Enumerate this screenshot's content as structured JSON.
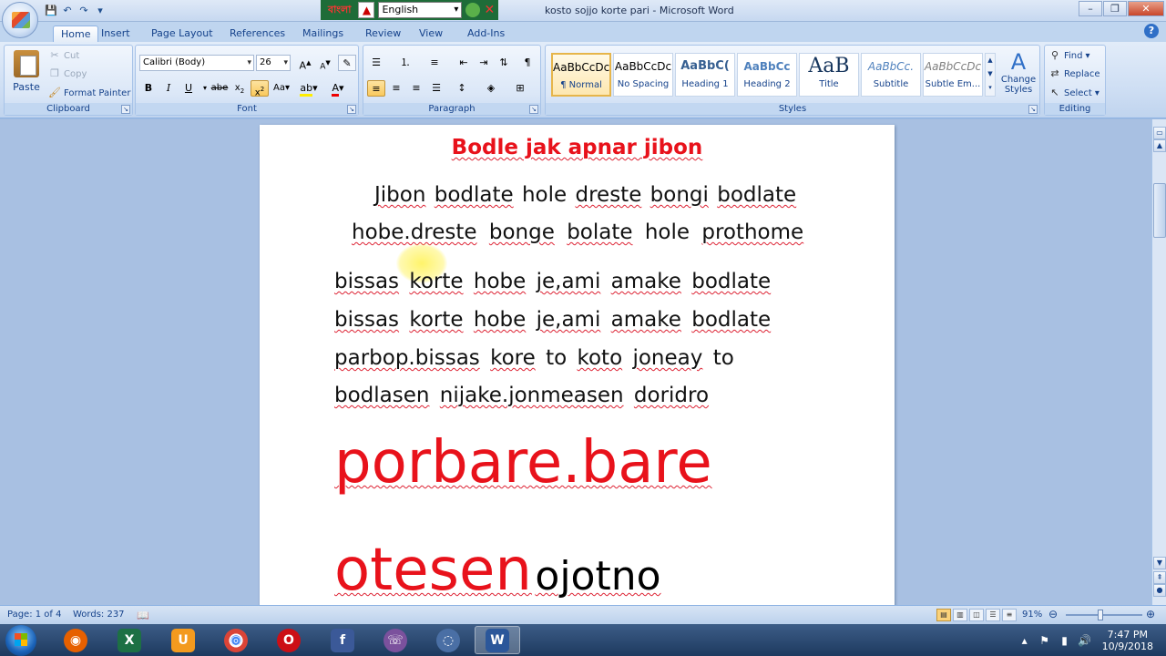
{
  "titlebar": {
    "title": "kosto sojjo korte pari - Microsoft Word",
    "bangla_brand": "বাংলা",
    "language": "English",
    "win_min": "–",
    "win_max": "❐",
    "win_close": "✕"
  },
  "quick_access": [
    "💾",
    "↶",
    "↷",
    "▾"
  ],
  "tabs": [
    "Home",
    "Insert",
    "Page Layout",
    "References",
    "Mailings",
    "Review",
    "View",
    "Add-Ins"
  ],
  "ribbon": {
    "clipboard": {
      "label": "Clipboard",
      "paste": "Paste",
      "cut": "Cut",
      "copy": "Copy",
      "format_painter": "Format Painter"
    },
    "font": {
      "label": "Font",
      "font_name": "Calibri (Body)",
      "font_size": "26"
    },
    "paragraph": {
      "label": "Paragraph"
    },
    "styles": {
      "label": "Styles",
      "gallery": [
        {
          "sample": "AaBbCcDc",
          "name": "¶ Normal"
        },
        {
          "sample": "AaBbCcDc",
          "name": "No Spacing"
        },
        {
          "sample": "AaBbC(",
          "name": "Heading 1"
        },
        {
          "sample": "AaBbCc",
          "name": "Heading 2"
        },
        {
          "sample": "AaB",
          "name": "Title"
        },
        {
          "sample": "AaBbCc.",
          "name": "Subtitle"
        },
        {
          "sample": "AaBbCcDc",
          "name": "Subtle Em..."
        }
      ],
      "change_styles": "Change Styles"
    },
    "editing": {
      "label": "Editing",
      "find": "Find",
      "replace": "Replace",
      "select": "Select"
    }
  },
  "document": {
    "title": "Bodle jak apnar jibon",
    "line1_words": [
      "Jibon",
      "bodlate",
      "hole",
      "dreste",
      "bongi",
      "bodlate"
    ],
    "line2_words": [
      "hobe.dreste",
      "bonge",
      "bolate",
      "hole",
      "prothome"
    ],
    "line3": [
      "bissas",
      "korte",
      "hobe",
      "je,ami",
      "amake",
      "bodlate"
    ],
    "line4": [
      "bissas",
      "korte",
      "hobe",
      "je,ami",
      "amake",
      "bodlate"
    ],
    "line5": [
      "parbop.bissas",
      "kore",
      "to",
      "koto",
      "joneay",
      "to"
    ],
    "line6": [
      "bodlasen",
      "nijake.jonmeasen",
      "doridro"
    ],
    "big1": "porbare.bare",
    "big2_red": "otesen",
    "big2_black": "ojotno"
  },
  "statusbar": {
    "page": "Page: 1 of 4",
    "words": "Words: 237",
    "zoom": "91%",
    "zoom_minus": "⊖",
    "zoom_plus": "⊕"
  },
  "taskbar": {
    "apps": [
      {
        "name": "firefox",
        "glyph": "◉",
        "color": "#e66000"
      },
      {
        "name": "excel",
        "glyph": "X",
        "color": "#1d7044"
      },
      {
        "name": "uc-browser",
        "glyph": "U",
        "color": "#f39a1e"
      },
      {
        "name": "chrome",
        "glyph": "◎",
        "color": "#2e8b3a"
      },
      {
        "name": "opera",
        "glyph": "O",
        "color": "#cc0f16"
      },
      {
        "name": "facebook",
        "glyph": "f",
        "color": "#3b5998"
      },
      {
        "name": "viber",
        "glyph": "☏",
        "color": "#7b519d"
      },
      {
        "name": "app-swirl",
        "glyph": "◌",
        "color": "#4a6fa5"
      },
      {
        "name": "word",
        "glyph": "W",
        "color": "#2b579a"
      }
    ],
    "time": "7:47 PM",
    "date": "10/9/2018"
  }
}
